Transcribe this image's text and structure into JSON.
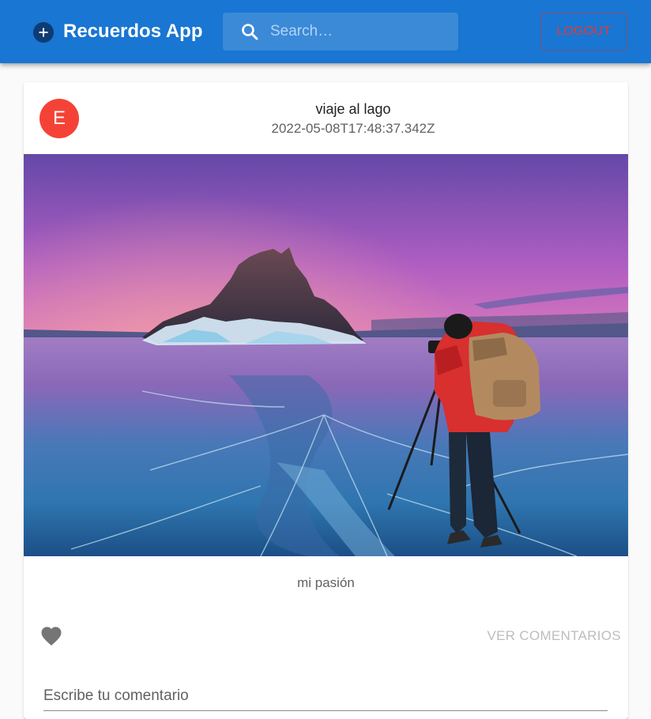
{
  "header": {
    "app_title": "Recuerdos App",
    "brand_icon": "add-circle-icon",
    "search_icon": "search-icon",
    "search_placeholder": "Search…",
    "logout_label": "LOGOUT",
    "bar_color": "#1976d2",
    "logout_color": "#e53935"
  },
  "post": {
    "avatar_letter": "E",
    "avatar_color": "#f44336",
    "title": "viaje al lago",
    "date": "2022-05-08T17:48:37.342Z",
    "image_description_icon": "photo-landscape",
    "caption": "mi pasión",
    "like_icon": "heart-icon",
    "view_comments_label": "VER COMENTARIOS",
    "comment_placeholder": "Escribe tu comentario"
  }
}
